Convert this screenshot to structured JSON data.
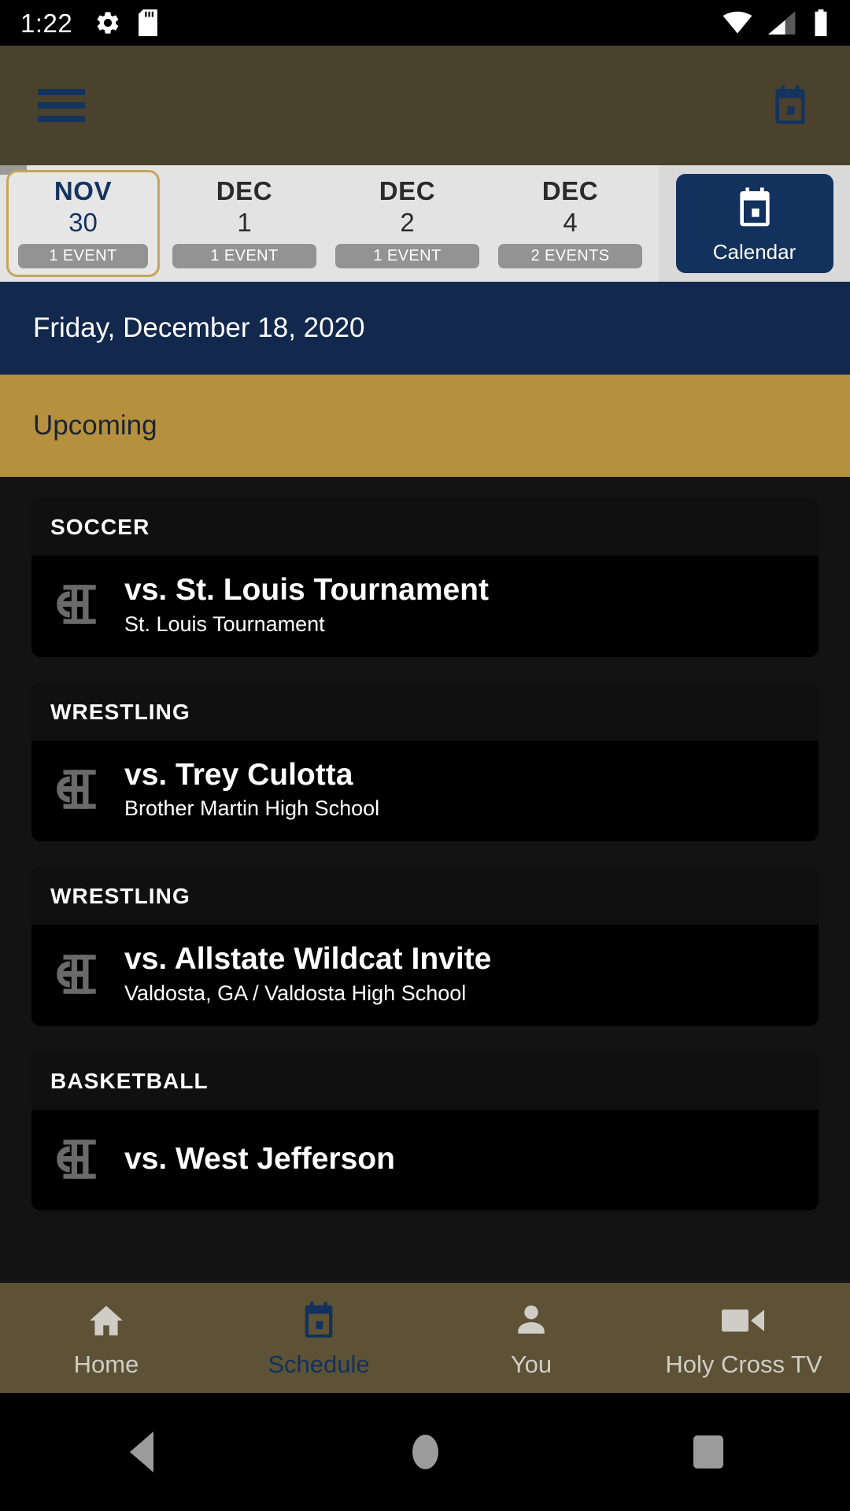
{
  "status_bar": {
    "time": "1:22",
    "left_icons": [
      "gear-icon",
      "sd-card-icon"
    ],
    "right_icons": [
      "wifi-icon",
      "cellular-signal-icon",
      "battery-icon"
    ]
  },
  "app_bar": {
    "menu_icon": "hamburger-menu-icon",
    "calendar_icon": "calendar-icon",
    "background_color": "#4a422c",
    "icon_color": "#14335e"
  },
  "date_strip": {
    "background_color": "#e3e3e3",
    "selected_border_color": "#c7a45a",
    "dates": [
      {
        "month": "NOV",
        "day": "30",
        "events": "1 EVENT",
        "selected": true
      },
      {
        "month": "DEC",
        "day": "1",
        "events": "1 EVENT",
        "selected": false
      },
      {
        "month": "DEC",
        "day": "2",
        "events": "1 EVENT",
        "selected": false
      },
      {
        "month": "DEC",
        "day": "4",
        "events": "2 EVENTS",
        "selected": false
      }
    ],
    "calendar_button": {
      "label": "Calendar",
      "icon": "calendar-icon",
      "background_color": "#12315c"
    }
  },
  "date_banner": {
    "text": "Friday, December 18, 2020",
    "background_color": "#12284c"
  },
  "section": {
    "title": "Upcoming",
    "background_color": "#b5903f"
  },
  "events": [
    {
      "sport": "SOCCER",
      "logo": "holy-cross-hc-monogram-logo",
      "title": "vs. St. Louis Tournament",
      "subtitle": "St. Louis Tournament"
    },
    {
      "sport": "WRESTLING",
      "logo": "holy-cross-hc-monogram-logo",
      "title": "vs. Trey Culotta",
      "subtitle": "Brother Martin High School"
    },
    {
      "sport": "WRESTLING",
      "logo": "holy-cross-hc-monogram-logo",
      "title": "vs. Allstate Wildcat Invite",
      "subtitle": "Valdosta, GA / Valdosta High School"
    },
    {
      "sport": "BASKETBALL",
      "logo": "holy-cross-hc-monogram-logo",
      "title": "vs. West Jefferson",
      "subtitle": ""
    }
  ],
  "bottom_nav": {
    "background_color": "#5d5235",
    "active_color": "#12315c",
    "inactive_color": "#cfcdc6",
    "items": [
      {
        "label": "Home",
        "icon": "home-icon",
        "active": false
      },
      {
        "label": "Schedule",
        "icon": "calendar-icon",
        "active": true
      },
      {
        "label": "You",
        "icon": "person-icon",
        "active": false
      },
      {
        "label": "Holy Cross TV",
        "icon": "video-camera-icon",
        "active": false
      }
    ]
  },
  "system_nav": {
    "buttons": [
      "back-button",
      "home-button",
      "recents-button"
    ]
  }
}
